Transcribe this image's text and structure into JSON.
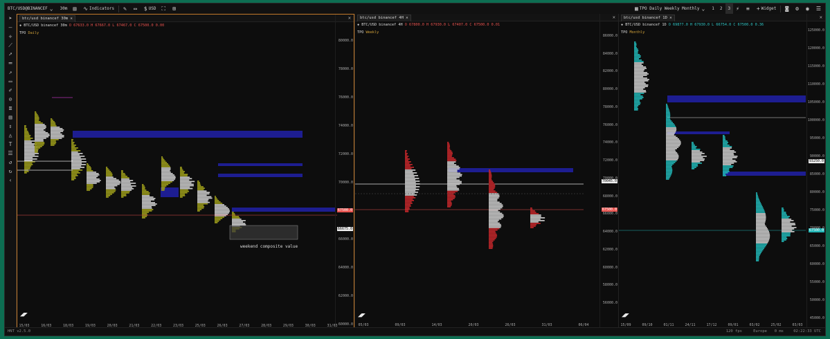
{
  "topbar": {
    "symbol": "BTC/USD@BINANCEF",
    "interval": "30m",
    "indicators_label": "Indicators",
    "currency": "USD",
    "layout_label": "TPO Daily Weekly Monthly",
    "pages": [
      "1",
      "2",
      "3"
    ],
    "widget_label": "Widget"
  },
  "panels": [
    {
      "tab": "btc/usd binancef 30m",
      "legend_symbol": "BTC/USD binancef 30m",
      "legend_ohlc": "O 67633.0 H 67667.0 L 67467.0 C 67500.0 0.00",
      "legend_tpo": "Daily",
      "price_labels": [
        "80000.0",
        "78000.0",
        "76000.0",
        "74000.0",
        "72000.0",
        "70000.0",
        "68000.0",
        "66000.0",
        "64000.0",
        "62000.0",
        "60000.0"
      ],
      "time_labels": [
        "15/03",
        "16/03",
        "18/03",
        "19/03",
        "20/03",
        "21/03",
        "22/03",
        "23/03",
        "25/03",
        "26/03",
        "27/03",
        "28/03",
        "29/03",
        "30/03",
        "31/03"
      ],
      "price_tags": [
        "67500.0",
        "66675.0"
      ],
      "annotation": "weekend composite value"
    },
    {
      "tab": "btc/usd binancef 4H",
      "legend_symbol": "BTC/USD binancef 4H",
      "legend_ohlc": "O 67800.0 H 67930.0 L 67407.0 C 67500.0 0.01",
      "legend_tpo": "Weekly",
      "price_labels": [
        "86000.0",
        "84000.0",
        "82000.0",
        "80000.0",
        "78000.0",
        "76000.0",
        "74000.0",
        "72000.0",
        "70000.0",
        "68000.0",
        "66000.0",
        "64000.0",
        "62000.0",
        "60000.0",
        "58000.0",
        "56000.0"
      ],
      "time_labels": [
        "05/03",
        "09/03",
        "14/03",
        "20/03",
        "26/03",
        "31/03",
        "06/04"
      ],
      "price_tags": [
        "70045.0",
        "67500.0"
      ]
    },
    {
      "tab": "btc/usd binancef 1D",
      "legend_symbol": "BTC/USD binancef 1D",
      "legend_ohlc": "O 69877.0 H 67930.0 L 66754.0 C 67500.0 0.36",
      "legend_tpo": "Monthly",
      "price_labels": [
        "125000.0",
        "120000.0",
        "115000.0",
        "110000.0",
        "105000.0",
        "100000.0",
        "95000.0",
        "90000.0",
        "85000.0",
        "80000.0",
        "75000.0",
        "70000.0",
        "65000.0",
        "60000.0",
        "55000.0",
        "50000.0",
        "45000.0"
      ],
      "time_labels": [
        "15/09",
        "09/10",
        "01/11",
        "24/11",
        "17/12",
        "09/01",
        "03/02",
        "25/02",
        "03/03"
      ],
      "price_tags": [
        "93250.0",
        "67500.0"
      ]
    }
  ],
  "footer": {
    "version": "HNT v2.5.0",
    "fps": "120 fps",
    "region": "Europe",
    "latency": "0 ms",
    "clock": "02:22:33 UTC"
  },
  "colors": {
    "accent_border": "#c47a2b",
    "value_area": "#1f1fa0",
    "profile_daily": "#9a9a1a",
    "profile_weekly": "#c0262a",
    "profile_monthly": "#20b2b2",
    "frame": "#0d6e52"
  }
}
